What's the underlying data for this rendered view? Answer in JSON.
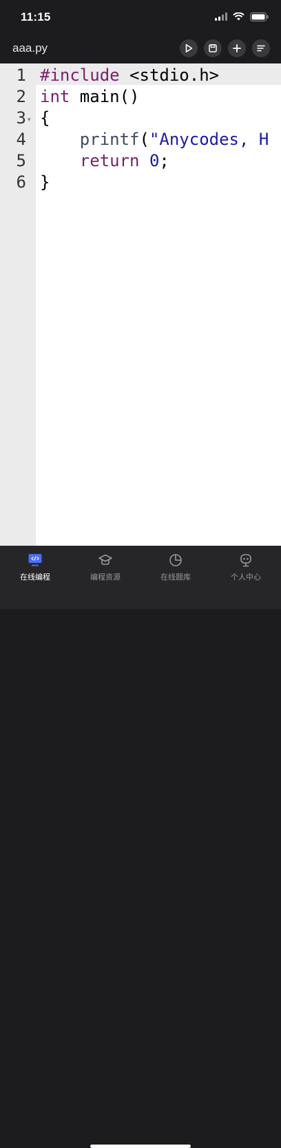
{
  "status": {
    "time": "11:15"
  },
  "header": {
    "filename": "aaa.py",
    "toolbar": [
      {
        "name": "run-button",
        "icon": "play-icon"
      },
      {
        "name": "save-button",
        "icon": "save-icon"
      },
      {
        "name": "add-button",
        "icon": "plus-icon"
      },
      {
        "name": "menu-button",
        "icon": "menu-lines-icon"
      }
    ]
  },
  "editor": {
    "lines": [
      {
        "n": "1",
        "tokens": [
          {
            "t": "#include",
            "c": "kw-pre"
          },
          {
            "t": " <stdio.h>",
            "c": ""
          }
        ]
      },
      {
        "n": "2",
        "tokens": [
          {
            "t": "int",
            "c": "kw"
          },
          {
            "t": " main()",
            "c": ""
          }
        ]
      },
      {
        "n": "3",
        "fold": true,
        "tokens": [
          {
            "t": "{",
            "c": ""
          }
        ]
      },
      {
        "n": "4",
        "tokens": [
          {
            "t": "    ",
            "c": ""
          },
          {
            "t": "printf",
            "c": "fn"
          },
          {
            "t": "(",
            "c": ""
          },
          {
            "t": "\"Anycodes, H",
            "c": "str"
          }
        ]
      },
      {
        "n": "5",
        "tokens": [
          {
            "t": "    ",
            "c": ""
          },
          {
            "t": "return",
            "c": "kw"
          },
          {
            "t": " ",
            "c": ""
          },
          {
            "t": "0",
            "c": "num"
          },
          {
            "t": ";",
            "c": ""
          }
        ]
      },
      {
        "n": "6",
        "tokens": [
          {
            "t": "}",
            "c": ""
          }
        ]
      }
    ]
  },
  "tabs": [
    {
      "label": "在线编程",
      "icon": "code-monitor-icon",
      "active": true
    },
    {
      "label": "编程资源",
      "icon": "graduation-cap-icon",
      "active": false
    },
    {
      "label": "在线题库",
      "icon": "pie-chart-icon",
      "active": false
    },
    {
      "label": "个人中心",
      "icon": "robot-face-icon",
      "active": false
    }
  ],
  "colors": {
    "accent": "#4a6cf7",
    "tab_bg": "#262628",
    "header_bg": "#1c1c1e"
  }
}
